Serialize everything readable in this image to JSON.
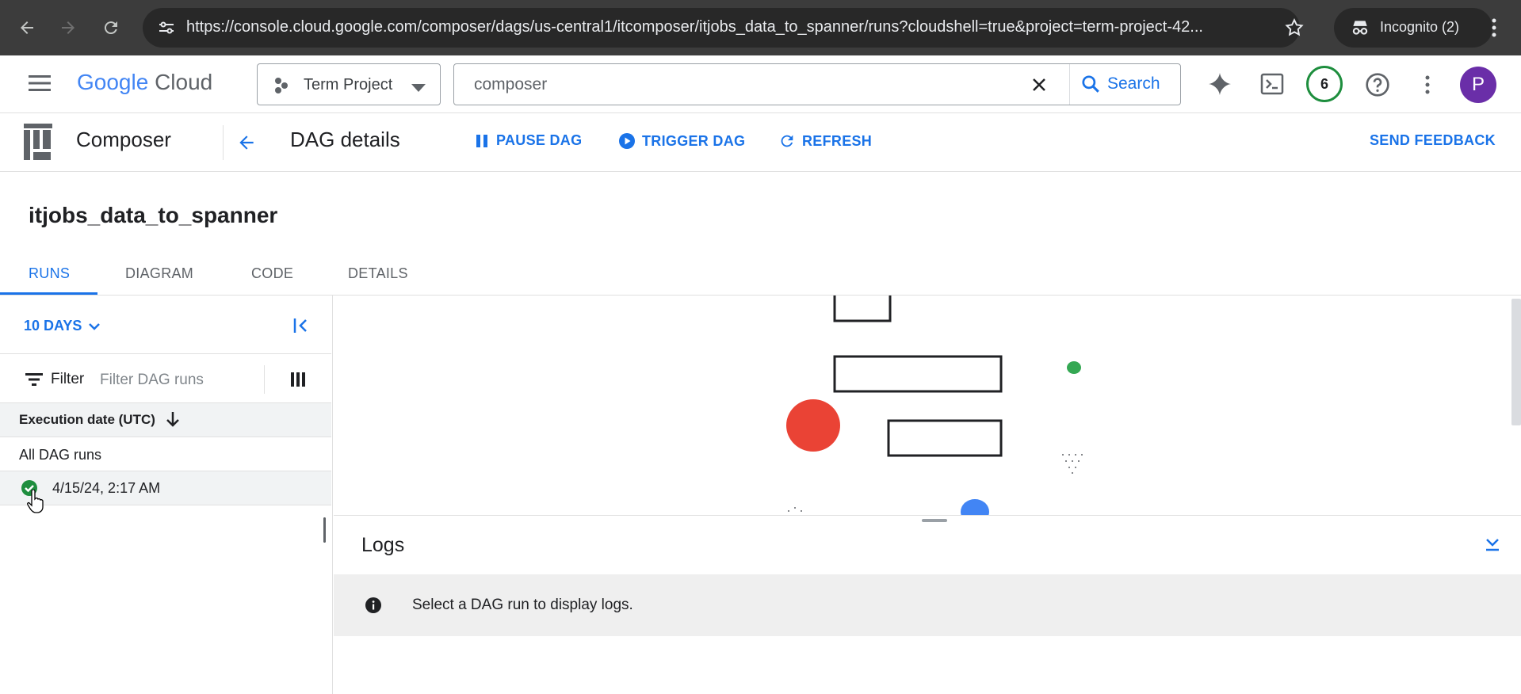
{
  "browser": {
    "url": "https://console.cloud.google.com/composer/dags/us-central1/itcomposer/itjobs_data_to_spanner/runs?cloudshell=true&project=term-project-42...",
    "incognito_label": "Incognito (2)"
  },
  "header": {
    "logo_google": "Google",
    "logo_cloud": "Cloud",
    "project": "Term Project",
    "search_value": "composer",
    "search_button": "Search",
    "notification_count": "6",
    "avatar_letter": "P"
  },
  "composer_bar": {
    "product": "Composer",
    "page_title": "DAG details",
    "pause_label": "PAUSE DAG",
    "trigger_label": "TRIGGER DAG",
    "refresh_label": "REFRESH",
    "feedback_label": "SEND FEEDBACK"
  },
  "dag": {
    "name": "itjobs_data_to_spanner"
  },
  "tabs": [
    {
      "label": "RUNS"
    },
    {
      "label": "DIAGRAM"
    },
    {
      "label": "CODE"
    },
    {
      "label": "DETAILS"
    }
  ],
  "runs_panel": {
    "range": "10 DAYS",
    "filter_label": "Filter",
    "filter_placeholder": "Filter DAG runs",
    "column_header": "Execution date (UTC)",
    "all_runs": "All DAG runs",
    "runs": [
      {
        "date": "4/15/24, 2:17 AM",
        "status": "success"
      }
    ]
  },
  "logs": {
    "title": "Logs",
    "info": "Select a DAG run to display logs."
  },
  "colors": {
    "accent": "#1a73e8",
    "success": "#1e8e3e",
    "avatar": "#6a2ea8",
    "node_red": "#ea4335",
    "node_green": "#34a853",
    "node_blue": "#4285f4"
  }
}
